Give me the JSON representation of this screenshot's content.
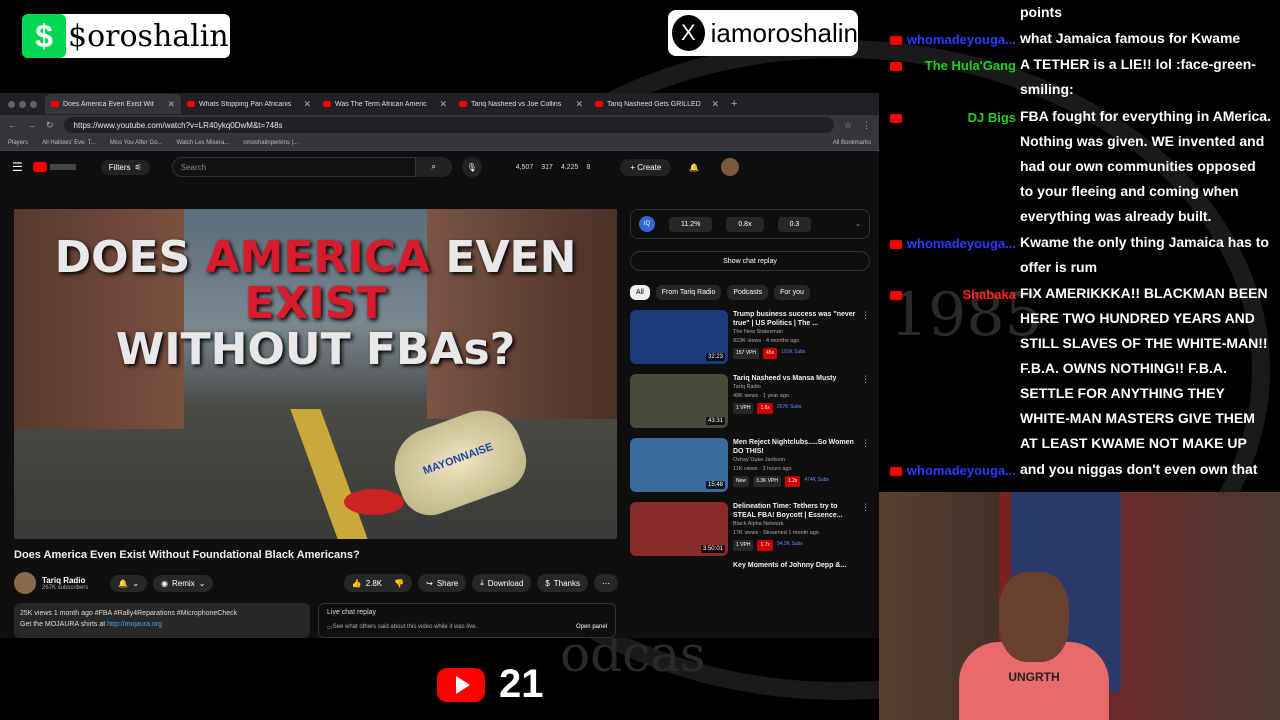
{
  "overlay": {
    "cashapp_symbol": "$",
    "cashapp_tag": "$oroshalin",
    "x_symbol": "X",
    "x_handle": "iamoroshalin",
    "yt_count": "21"
  },
  "browser": {
    "tabs": [
      {
        "label": "Does America Even Exist Wit",
        "active": true
      },
      {
        "label": "Whats Stopping Pan Africanis",
        "active": false
      },
      {
        "label": "Was The Term African Americ",
        "active": false
      },
      {
        "label": "Tariq Nasheed vs Joe Collins",
        "active": false
      },
      {
        "label": "Tariq Nasheed Gets GRILLED",
        "active": false
      }
    ],
    "url": "https://www.youtube.com/watch?v=LR40ykq0DwM&t=748s",
    "bookmarks": [
      "Players",
      "All Hallows' Eve: T...",
      "Miss You After Go...",
      "Watch Les Misera...",
      "omoshalinperkins |..."
    ],
    "bookmarks_right": "All Bookmarks"
  },
  "youtube": {
    "filters_label": "Filters",
    "search_placeholder": "Search",
    "stats": [
      "4,507",
      "317",
      "4,225",
      "8"
    ],
    "create_label": "Create",
    "thumbnail_line1_a": "DOES ",
    "thumbnail_line1_b": "AMERICA",
    "thumbnail_line1_c": " EVEN ",
    "thumbnail_line1_d": "EXIST",
    "thumbnail_line2": "WITHOUT FBAs?",
    "thumbnail_jar": "MAYONNAISE",
    "video_title": "Does America Even Exist Without Foundational Black Americans?",
    "channel_name": "Tariq Radio",
    "channel_subs": "267K subscribers",
    "remix_label": "Remix",
    "likes": "2.8K",
    "share_label": "Share",
    "download_label": "Download",
    "thanks_label": "Thanks",
    "desc_line1": "25K views  1 month ago  #FBA #Rally4Reparations #MicrophoneCheck",
    "desc_line2": "Get the MOJAURA shirts  at",
    "desc_link": "http://mojaura.org",
    "livechat_title": "Live chat replay",
    "livechat_sub": "See what others said about this video while it was live.",
    "livechat_open": "Open panel",
    "iq_values": [
      "11.2%",
      "0.8x",
      "0.3"
    ],
    "show_replay": "Show chat replay",
    "chips": [
      "All",
      "From Tariq Radio",
      "Podcasts",
      "For you"
    ],
    "recs": [
      {
        "title": "Trump business success was \"never true\" | US Politics | The ...",
        "channel": "The New Statesman",
        "meta": "923K views · 4 months ago",
        "dur": "32:23",
        "tags": [
          "157 VPH",
          "45x",
          "191K Subs"
        ],
        "color": "#1a3a7a"
      },
      {
        "title": "Tariq Nasheed vs Mansa Musty",
        "channel": "Tariq Radio",
        "meta": "49K views · 1 year ago",
        "dur": "43:31",
        "tags": [
          "1 VPH",
          "1.6x",
          "267K Subs"
        ],
        "color": "#4a4a3a"
      },
      {
        "title": "Men Reject Nightclubs.....So Women DO THIS!",
        "channel": "Oshay Duke Jackson",
        "meta": "11K views · 3 hours ago",
        "dur": "15:48",
        "tags": [
          "New",
          "3.3K VPH",
          "1.2x",
          "474K Subs"
        ],
        "color": "#3a6a9a"
      },
      {
        "title": "Delineation Time: Tethers try to STEAL FBA! Boycott | Essence...",
        "channel": "Black Alpha Network",
        "meta": "17K views · Streamed 1 month ago",
        "dur": "3:50:01",
        "tags": [
          "1 VPH",
          "1.7x",
          "34.2K Subs"
        ],
        "color": "#8a2a2a"
      }
    ],
    "more_rec": "Key Moments of Johnny Depp &..."
  },
  "chat": [
    {
      "name": "",
      "text": "points",
      "color": "#ffffff"
    },
    {
      "name": "whomadeyouga...",
      "text": "what Jamaica famous for Kwame",
      "color": "#2a3aff"
    },
    {
      "name": "The Hula'Gang",
      "text": "A TETHER is a LIE!! lol :face-green-smiling:",
      "color": "#22cc22"
    },
    {
      "name": "DJ Bigs",
      "text": "FBA fought for everything in AMerica. Nothing was given. WE invented and had our own communities opposed to your fleeing and coming when everything was already built.",
      "color": "#22cc22"
    },
    {
      "name": "whomadeyouga...",
      "text": "Kwame the only thing Jamaica has to offer is rum",
      "color": "#2a3aff"
    },
    {
      "name": "Shabaka",
      "text": "FIX AMERIKKKA!! BLACKMAN BEEN HERE TWO HUNDRED YEARS AND STILL SLAVES OF THE WHITE-MAN!! F.B.A. OWNS NOTHING!! F.B.A. SETTLE FOR ANYTHING THEY WHITE-MAN MASTERS GIVE THEM AT LEAST KWAME NOT MAKE UP",
      "color": "#ff2222"
    },
    {
      "name": "whomadeyouga...",
      "text": "and you niggas don't even own that",
      "color": "#2a3aff"
    }
  ],
  "cam": {
    "shirt_text": "UNGRTH"
  },
  "watermark": {
    "year": "1985",
    "bottom": "odcas"
  }
}
